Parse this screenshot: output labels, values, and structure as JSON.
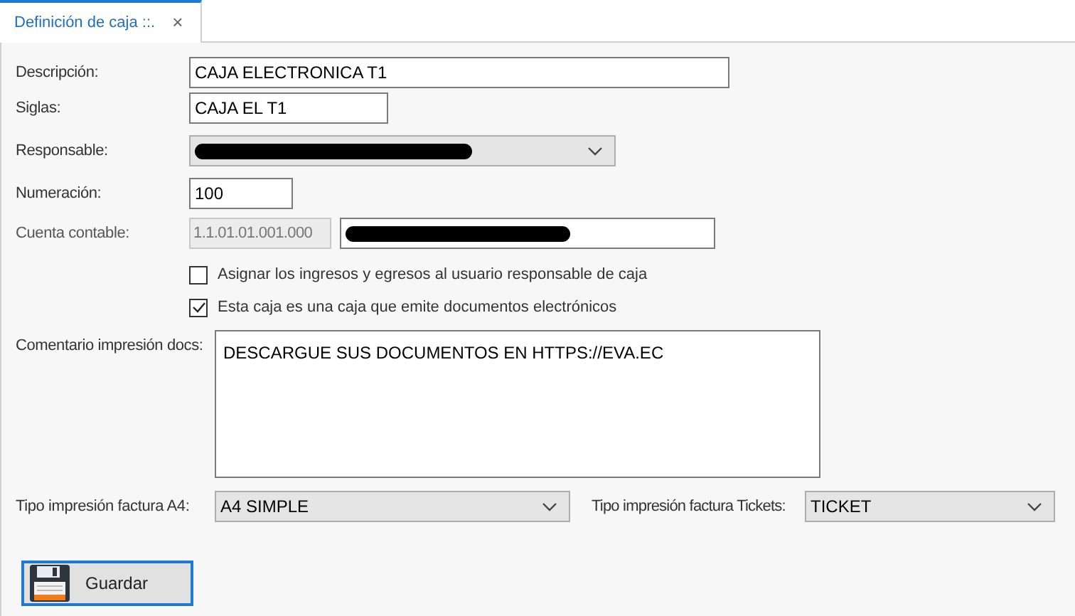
{
  "tab": {
    "title": "Definición de caja ::.",
    "close": "×",
    "selected": true
  },
  "fields": {
    "descripcion": {
      "label": "Descripción:",
      "value": "CAJA ELECTRONICA T1"
    },
    "siglas": {
      "label": "Siglas:",
      "value": "CAJA EL T1"
    },
    "responsable": {
      "label": "Responsable:",
      "redacted": true
    },
    "numeracion": {
      "label": "Numeración:",
      "value": "100"
    },
    "cuenta": {
      "label": "Cuenta contable:",
      "code": "1.1.01.01.001.000",
      "redacted": true
    }
  },
  "checkboxes": [
    {
      "label": "Asignar los ingresos y egresos al usuario responsable de caja",
      "checked": false
    },
    {
      "label": "Esta caja es una caja que emite documentos electrónicos",
      "checked": true
    }
  ],
  "comentario": {
    "label": "Comentario impresión docs:",
    "value": "DESCARGUE SUS DOCUMENTOS EN HTTPS://EVA.EC"
  },
  "tipo_a4": {
    "label": "Tipo impresión factura A4:",
    "value": "A4 SIMPLE"
  },
  "tipo_tickets": {
    "label": "Tipo impresión factura Tickets:",
    "value": "TICKET"
  },
  "save_button": {
    "label": "Guardar"
  }
}
